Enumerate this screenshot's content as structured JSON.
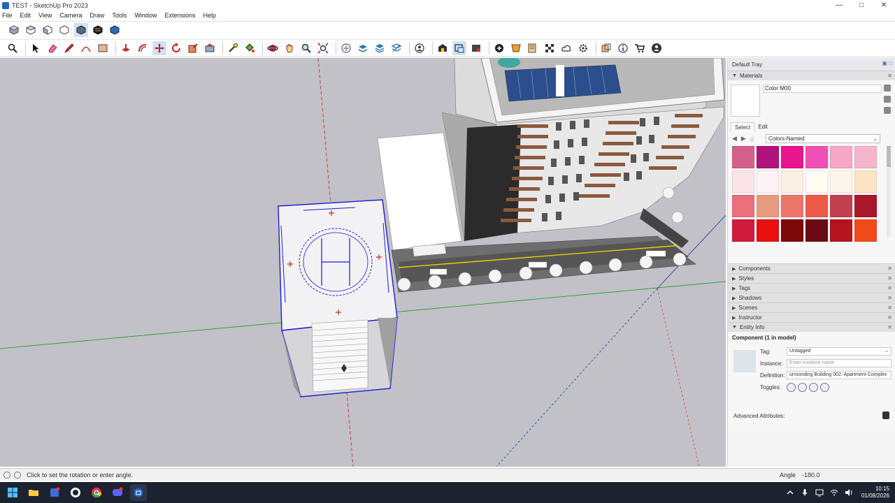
{
  "window": {
    "title": "TEST - SketchUp Pro 2023"
  },
  "menu": [
    "File",
    "Edit",
    "View",
    "Camera",
    "Draw",
    "Tools",
    "Window",
    "Extensions",
    "Help"
  ],
  "toolbar_top": [
    "iso-view-icon",
    "top-view-icon",
    "front-view-icon",
    "right-view-icon",
    "back-view-icon",
    "left-view-icon",
    "bottom-view-icon"
  ],
  "toolbar_main": [
    "search-icon",
    "select-icon",
    "eraser-icon",
    "pencil-line-icon",
    "arc-icon",
    "rectangle-icon",
    "push-pull-icon",
    "offset-icon",
    "move-icon",
    "rotate-icon",
    "scale-icon",
    "follow-me-icon",
    "tape-measure-icon",
    "paint-bucket-icon",
    "orbit-icon",
    "pan-icon",
    "zoom-icon",
    "zoom-extents-icon",
    "section-plane-icon",
    "tag-icon",
    "layers-icon",
    "walk-icon",
    "profile-icon",
    "warehouse-icon",
    "extension-icon",
    "photo-icon",
    "texture-icon",
    "cloud-icon",
    "settings-icon",
    "solid-icon",
    "info-icon",
    "cart-icon",
    "account-icon"
  ],
  "tray": {
    "title": "Default Tray",
    "materials": {
      "header": "Materials",
      "current_name": "Color M00",
      "tab_select": "Select",
      "tab_edit": "Edit",
      "library": "Colors-Named",
      "swatches": [
        "#d4608a",
        "#b0137a",
        "#e8158e",
        "#f050b4",
        "#f7a6c6",
        "#f5b6cc",
        "#fbe4e8",
        "#fdf2f4",
        "#fbf0e6",
        "#fffcf4",
        "#fdf5ec",
        "#fbe3c4",
        "#e9707c",
        "#e79a7e",
        "#ec766a",
        "#ec5a48",
        "#c04050",
        "#a8182a",
        "#d01a3e",
        "#e81010",
        "#7c0808",
        "#6a0a14",
        "#b6141e",
        "#f04a1a"
      ]
    },
    "panels": [
      "Components",
      "Styles",
      "Tags",
      "Shadows",
      "Scenes",
      "Instructor"
    ],
    "entity_info": {
      "header": "Entity Info",
      "title": "Component (1 in model)",
      "tag_label": "Tag:",
      "tag_value": "Untagged",
      "instance_label": "Instance:",
      "instance_placeholder": "Enter instance name",
      "definition_label": "Definition:",
      "definition_value": "urrounding Building 002: Apartment Complex",
      "toggles_label": "Toggles:",
      "advanced": "Advanced Attributes:"
    }
  },
  "status": {
    "message": "Click to set the rotation or enter angle.",
    "angle_label": "Angle",
    "angle_value": "-180.0"
  },
  "taskbar": {
    "time": "10:15",
    "date": "01/08/2026"
  },
  "colors": {
    "viewport_bg": "#c1c1c7",
    "selection": "#1d1dd6",
    "red_axis": "#d42020",
    "green_axis": "#1a9a1a",
    "blue_axis": "#2030c0"
  }
}
